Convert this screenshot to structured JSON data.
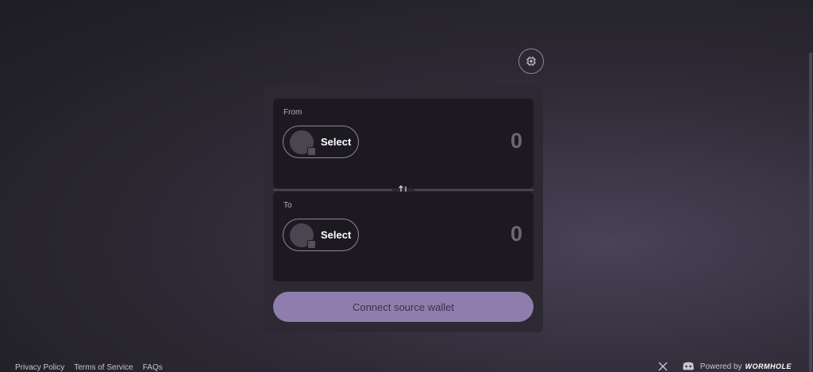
{
  "settings": {
    "icon": "gear-icon"
  },
  "from": {
    "label": "From",
    "select_label": "Select",
    "amount": "0"
  },
  "to": {
    "label": "To",
    "select_label": "Select",
    "amount": "0"
  },
  "swap": {
    "icon": "swap-arrows-icon"
  },
  "connect_button": {
    "label": "Connect source wallet"
  },
  "footer": {
    "links": [
      "Privacy Policy",
      "Terms of Service",
      "FAQs"
    ],
    "powered_by": "Powered by",
    "brand": "WORMHOLE"
  },
  "colors": {
    "accent": "#8f7ead",
    "panel": "#1c1a20",
    "widget": "#2c2932"
  }
}
